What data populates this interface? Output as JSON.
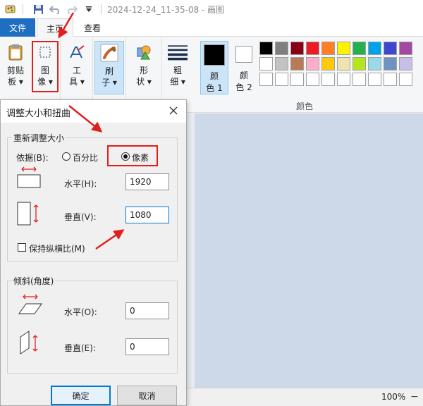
{
  "window": {
    "title": "2024-12-24_11-35-08 - 画图"
  },
  "tabs": {
    "file": "文件",
    "home": "主页",
    "view": "查看"
  },
  "ribbon": {
    "clipboard": [
      "剪贴",
      "板 ▾"
    ],
    "image": [
      "图",
      "像 ▾"
    ],
    "tools": [
      "工",
      "具 ▾"
    ],
    "brush": [
      "刷",
      "子 ▾"
    ],
    "shapes": [
      "形",
      "状 ▾"
    ],
    "size": [
      "粗",
      "细 ▾"
    ],
    "color1": [
      "颜",
      "色 1"
    ],
    "color2": [
      "颜",
      "色 2"
    ],
    "colors_group_label": "颜色",
    "color1_value": "#000000",
    "color2_value": "#ffffff",
    "palette": [
      "#000000",
      "#7f7f7f",
      "#880015",
      "#ed1c24",
      "#ff7f27",
      "#fff200",
      "#22b14c",
      "#00a2e8",
      "#3f48cc",
      "#a349a4",
      "#ffffff",
      "#c3c3c3",
      "#b97a57",
      "#ffaec9",
      "#ffc90e",
      "#efe4b0",
      "#b5e61d",
      "#99d9ea",
      "#7092be",
      "#c8bfe7",
      "#ffffff",
      "#ffffff",
      "#ffffff",
      "#ffffff",
      "#ffffff",
      "#ffffff",
      "#ffffff",
      "#ffffff",
      "#ffffff",
      "#ffffff"
    ]
  },
  "dialog": {
    "title": "调整大小和扭曲",
    "resize_section": "重新调整大小",
    "basis_label": "依据(B):",
    "percent_label": "百分比",
    "pixels_label": "像素",
    "horizontal_label": "水平(H):",
    "horizontal_value": "1920",
    "vertical_label": "垂直(V):",
    "vertical_value": "1080",
    "keep_ratio_label": "保持纵横比(M)",
    "skew_section": "倾斜(角度)",
    "skew_horizontal_label": "水平(O):",
    "skew_horizontal_value": "0",
    "skew_vertical_label": "垂直(E):",
    "skew_vertical_value": "0",
    "ok_label": "确定",
    "cancel_label": "取消"
  },
  "status": {
    "zoom": "100%",
    "zoom_out": "−"
  },
  "colors": {
    "accent": "#1e6fc2",
    "annotation": "#e0201c"
  }
}
